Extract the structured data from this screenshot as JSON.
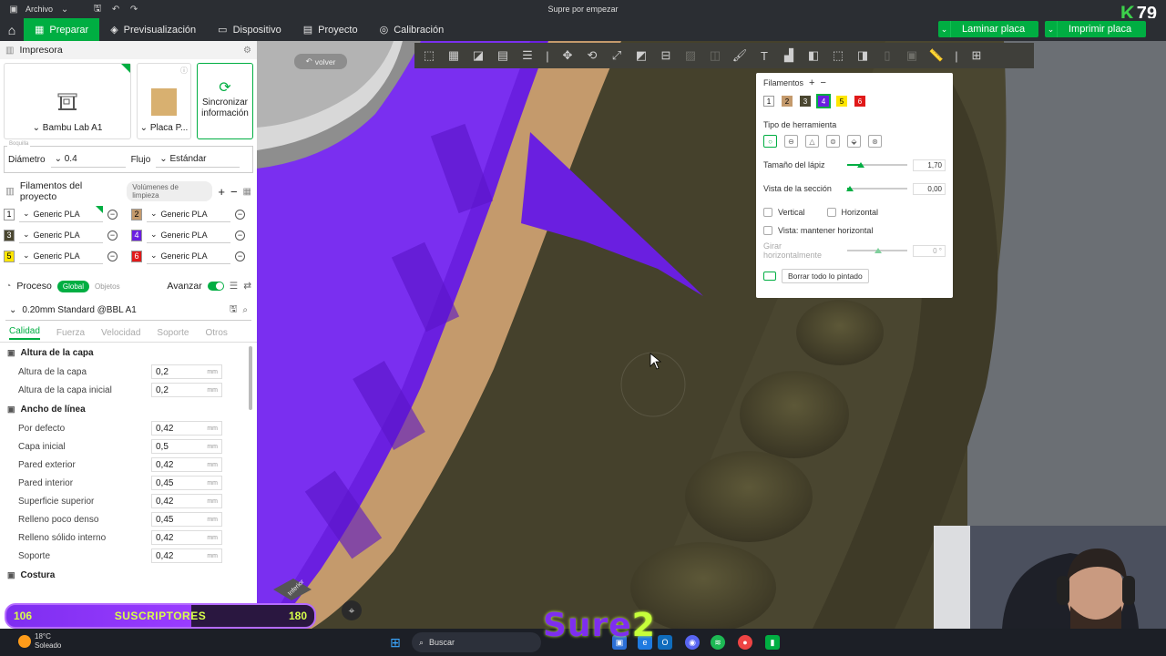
{
  "window": {
    "title": "Supre por empezar",
    "menu": "Archivo",
    "counter": "79"
  },
  "nav": {
    "tabs": [
      {
        "label": "Preparar"
      },
      {
        "label": "Previsualización"
      },
      {
        "label": "Dispositivo"
      },
      {
        "label": "Proyecto"
      },
      {
        "label": "Calibración"
      }
    ],
    "slice_label": "Laminar placa",
    "print_label": "Imprimir placa"
  },
  "printer": {
    "section_title": "Impresora",
    "printer_name": "Bambu Lab A1",
    "plate_name": "Placa P...",
    "sync_label": "Sincronizar información",
    "nozzle_group": "Boquilla",
    "diameter_label": "Diámetro",
    "diameter_value": "0.4",
    "flow_label": "Flujo",
    "flow_value": "Estándar"
  },
  "filaments": {
    "section_title": "Filamentos del proyecto",
    "purge_label": "Volúmenes de limpieza",
    "items": [
      {
        "num": "1",
        "name": "Generic PLA",
        "color": "#ffffff",
        "text": "#000000"
      },
      {
        "num": "2",
        "name": "Generic PLA",
        "color": "#c49a6c",
        "text": "#000000"
      },
      {
        "num": "3",
        "name": "Generic PLA",
        "color": "#4a4630",
        "text": "#ffffff"
      },
      {
        "num": "4",
        "name": "Generic PLA",
        "color": "#6a1fe0",
        "text": "#ffffff"
      },
      {
        "num": "5",
        "name": "Generic PLA",
        "color": "#ffe600",
        "text": "#000000"
      },
      {
        "num": "6",
        "name": "Generic PLA",
        "color": "#e01919",
        "text": "#ffffff"
      }
    ]
  },
  "process": {
    "section_title": "Proceso",
    "global_label": "Global",
    "objects_label": "Objetos",
    "advanced_label": "Avanzar",
    "preset": "0.20mm Standard @BBL A1",
    "tabs": [
      "Calidad",
      "Fuerza",
      "Velocidad",
      "Soporte",
      "Otros"
    ],
    "groups": [
      {
        "title": "Altura de la capa",
        "params": [
          {
            "label": "Altura de la capa",
            "value": "0,2",
            "unit": "mm"
          },
          {
            "label": "Altura de la capa inicial",
            "value": "0,2",
            "unit": "mm"
          }
        ]
      },
      {
        "title": "Ancho de línea",
        "params": [
          {
            "label": "Por defecto",
            "value": "0,42",
            "unit": "mm"
          },
          {
            "label": "Capa inicial",
            "value": "0,5",
            "unit": "mm"
          },
          {
            "label": "Pared exterior",
            "value": "0,42",
            "unit": "mm"
          },
          {
            "label": "Pared interior",
            "value": "0,45",
            "unit": "mm"
          },
          {
            "label": "Superficie superior",
            "value": "0,42",
            "unit": "mm"
          },
          {
            "label": "Relleno poco denso",
            "value": "0,45",
            "unit": "mm"
          },
          {
            "label": "Relleno sólido interno",
            "value": "0,42",
            "unit": "mm"
          },
          {
            "label": "Soporte",
            "value": "0,42",
            "unit": "mm"
          }
        ]
      },
      {
        "title": "Costura",
        "params": []
      }
    ]
  },
  "viewport": {
    "back_label": "volver",
    "cube_label": "Inferior"
  },
  "paint_panel": {
    "filaments_label": "Filamentos",
    "swatches": [
      {
        "num": "1",
        "color": "#ffffff",
        "text": "#000000"
      },
      {
        "num": "2",
        "color": "#c49a6c",
        "text": "#000000"
      },
      {
        "num": "3",
        "color": "#4a4630",
        "text": "#ffffff"
      },
      {
        "num": "4",
        "color": "#6a1fe0",
        "text": "#ffffff"
      },
      {
        "num": "5",
        "color": "#ffe600",
        "text": "#000000"
      },
      {
        "num": "6",
        "color": "#e01919",
        "text": "#ffffff"
      }
    ],
    "tool_type_label": "Tipo de herramienta",
    "pen_size_label": "Tamaño del lápiz",
    "pen_size_value": "1,70",
    "pen_size_fraction": 0.23,
    "section_view_label": "Vista de la sección",
    "section_view_value": "0,00",
    "section_view_fraction": 0.05,
    "vertical_label": "Vertical",
    "horizontal_label": "Horizontal",
    "keep_horizontal_label": "Vista: mantener horizontal",
    "rotate_label": "Girar horizontalmente",
    "rotate_value": "0 °",
    "clear_label": "Borrar todo lo pintado"
  },
  "stream": {
    "subs_current": "106",
    "subs_label": "SUSCRIPTORES",
    "subs_goal": "180",
    "logo_a": "Sure",
    "logo_b": "2"
  },
  "taskbar": {
    "temp": "18°C",
    "weather": "Soleado",
    "search": "Buscar"
  },
  "colors": {
    "accent": "#00ae42",
    "purple": "#6a1fe0",
    "tan": "#c49a6c",
    "olive": "#4a4630"
  }
}
